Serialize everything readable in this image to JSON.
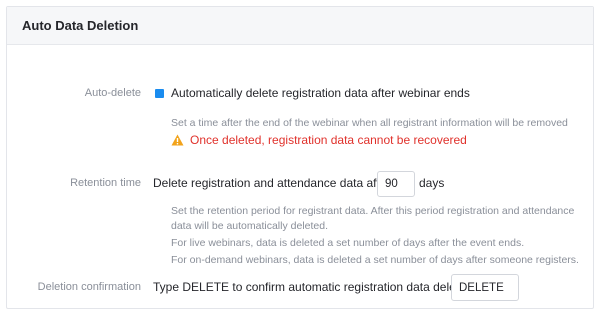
{
  "header": {
    "title": "Auto Data Deletion"
  },
  "auto_delete": {
    "label": "Auto-delete",
    "checkbox_checked": true,
    "checkbox_label": "Automatically delete registration data after webinar ends",
    "help": "Set a time after the end of the webinar when all registrant information will be removed",
    "warning": "Once deleted, registration data cannot be recovered"
  },
  "retention": {
    "label": "Retention time",
    "text_before": "Delete registration and attendance data after",
    "value": "90",
    "text_after": "days",
    "help_1": "Set the retention period for registrant data. After this period registration and attendance data will be automatically deleted.",
    "help_2": "For live webinars, data is deleted a set number of days after the event ends.",
    "help_3": "For on-demand webinars, data is deleted a set number of days after someone registers."
  },
  "confirmation": {
    "label": "Deletion confirmation",
    "text": "Type DELETE to confirm automatic registration data deletion",
    "value": "DELETE"
  },
  "colors": {
    "accent": "#1a8cef",
    "warning": "#e0312b",
    "warning_icon": "#f2a31b"
  }
}
